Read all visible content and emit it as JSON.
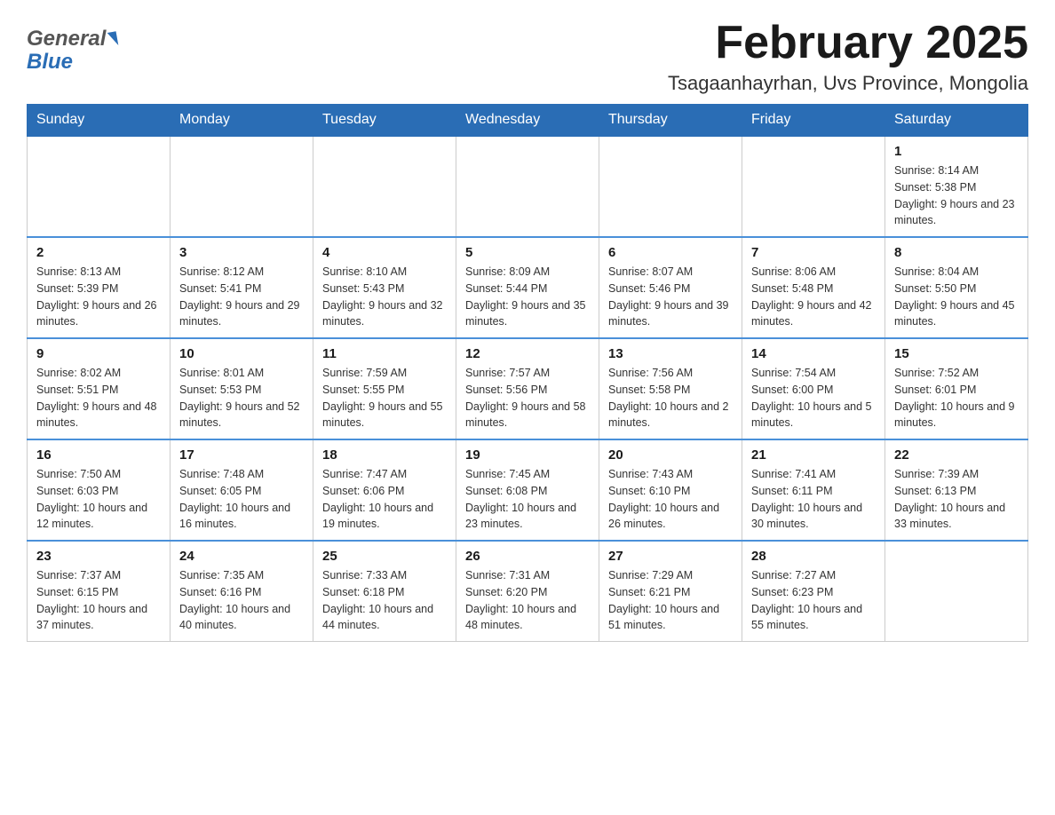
{
  "header": {
    "logo": {
      "general": "General",
      "blue": "Blue"
    },
    "title": "February 2025",
    "subtitle": "Tsagaanhayrhan, Uvs Province, Mongolia"
  },
  "calendar": {
    "days_of_week": [
      "Sunday",
      "Monday",
      "Tuesday",
      "Wednesday",
      "Thursday",
      "Friday",
      "Saturday"
    ],
    "weeks": [
      [
        {
          "day": "",
          "info": ""
        },
        {
          "day": "",
          "info": ""
        },
        {
          "day": "",
          "info": ""
        },
        {
          "day": "",
          "info": ""
        },
        {
          "day": "",
          "info": ""
        },
        {
          "day": "",
          "info": ""
        },
        {
          "day": "1",
          "info": "Sunrise: 8:14 AM\nSunset: 5:38 PM\nDaylight: 9 hours and 23 minutes."
        }
      ],
      [
        {
          "day": "2",
          "info": "Sunrise: 8:13 AM\nSunset: 5:39 PM\nDaylight: 9 hours and 26 minutes."
        },
        {
          "day": "3",
          "info": "Sunrise: 8:12 AM\nSunset: 5:41 PM\nDaylight: 9 hours and 29 minutes."
        },
        {
          "day": "4",
          "info": "Sunrise: 8:10 AM\nSunset: 5:43 PM\nDaylight: 9 hours and 32 minutes."
        },
        {
          "day": "5",
          "info": "Sunrise: 8:09 AM\nSunset: 5:44 PM\nDaylight: 9 hours and 35 minutes."
        },
        {
          "day": "6",
          "info": "Sunrise: 8:07 AM\nSunset: 5:46 PM\nDaylight: 9 hours and 39 minutes."
        },
        {
          "day": "7",
          "info": "Sunrise: 8:06 AM\nSunset: 5:48 PM\nDaylight: 9 hours and 42 minutes."
        },
        {
          "day": "8",
          "info": "Sunrise: 8:04 AM\nSunset: 5:50 PM\nDaylight: 9 hours and 45 minutes."
        }
      ],
      [
        {
          "day": "9",
          "info": "Sunrise: 8:02 AM\nSunset: 5:51 PM\nDaylight: 9 hours and 48 minutes."
        },
        {
          "day": "10",
          "info": "Sunrise: 8:01 AM\nSunset: 5:53 PM\nDaylight: 9 hours and 52 minutes."
        },
        {
          "day": "11",
          "info": "Sunrise: 7:59 AM\nSunset: 5:55 PM\nDaylight: 9 hours and 55 minutes."
        },
        {
          "day": "12",
          "info": "Sunrise: 7:57 AM\nSunset: 5:56 PM\nDaylight: 9 hours and 58 minutes."
        },
        {
          "day": "13",
          "info": "Sunrise: 7:56 AM\nSunset: 5:58 PM\nDaylight: 10 hours and 2 minutes."
        },
        {
          "day": "14",
          "info": "Sunrise: 7:54 AM\nSunset: 6:00 PM\nDaylight: 10 hours and 5 minutes."
        },
        {
          "day": "15",
          "info": "Sunrise: 7:52 AM\nSunset: 6:01 PM\nDaylight: 10 hours and 9 minutes."
        }
      ],
      [
        {
          "day": "16",
          "info": "Sunrise: 7:50 AM\nSunset: 6:03 PM\nDaylight: 10 hours and 12 minutes."
        },
        {
          "day": "17",
          "info": "Sunrise: 7:48 AM\nSunset: 6:05 PM\nDaylight: 10 hours and 16 minutes."
        },
        {
          "day": "18",
          "info": "Sunrise: 7:47 AM\nSunset: 6:06 PM\nDaylight: 10 hours and 19 minutes."
        },
        {
          "day": "19",
          "info": "Sunrise: 7:45 AM\nSunset: 6:08 PM\nDaylight: 10 hours and 23 minutes."
        },
        {
          "day": "20",
          "info": "Sunrise: 7:43 AM\nSunset: 6:10 PM\nDaylight: 10 hours and 26 minutes."
        },
        {
          "day": "21",
          "info": "Sunrise: 7:41 AM\nSunset: 6:11 PM\nDaylight: 10 hours and 30 minutes."
        },
        {
          "day": "22",
          "info": "Sunrise: 7:39 AM\nSunset: 6:13 PM\nDaylight: 10 hours and 33 minutes."
        }
      ],
      [
        {
          "day": "23",
          "info": "Sunrise: 7:37 AM\nSunset: 6:15 PM\nDaylight: 10 hours and 37 minutes."
        },
        {
          "day": "24",
          "info": "Sunrise: 7:35 AM\nSunset: 6:16 PM\nDaylight: 10 hours and 40 minutes."
        },
        {
          "day": "25",
          "info": "Sunrise: 7:33 AM\nSunset: 6:18 PM\nDaylight: 10 hours and 44 minutes."
        },
        {
          "day": "26",
          "info": "Sunrise: 7:31 AM\nSunset: 6:20 PM\nDaylight: 10 hours and 48 minutes."
        },
        {
          "day": "27",
          "info": "Sunrise: 7:29 AM\nSunset: 6:21 PM\nDaylight: 10 hours and 51 minutes."
        },
        {
          "day": "28",
          "info": "Sunrise: 7:27 AM\nSunset: 6:23 PM\nDaylight: 10 hours and 55 minutes."
        },
        {
          "day": "",
          "info": ""
        }
      ]
    ]
  }
}
